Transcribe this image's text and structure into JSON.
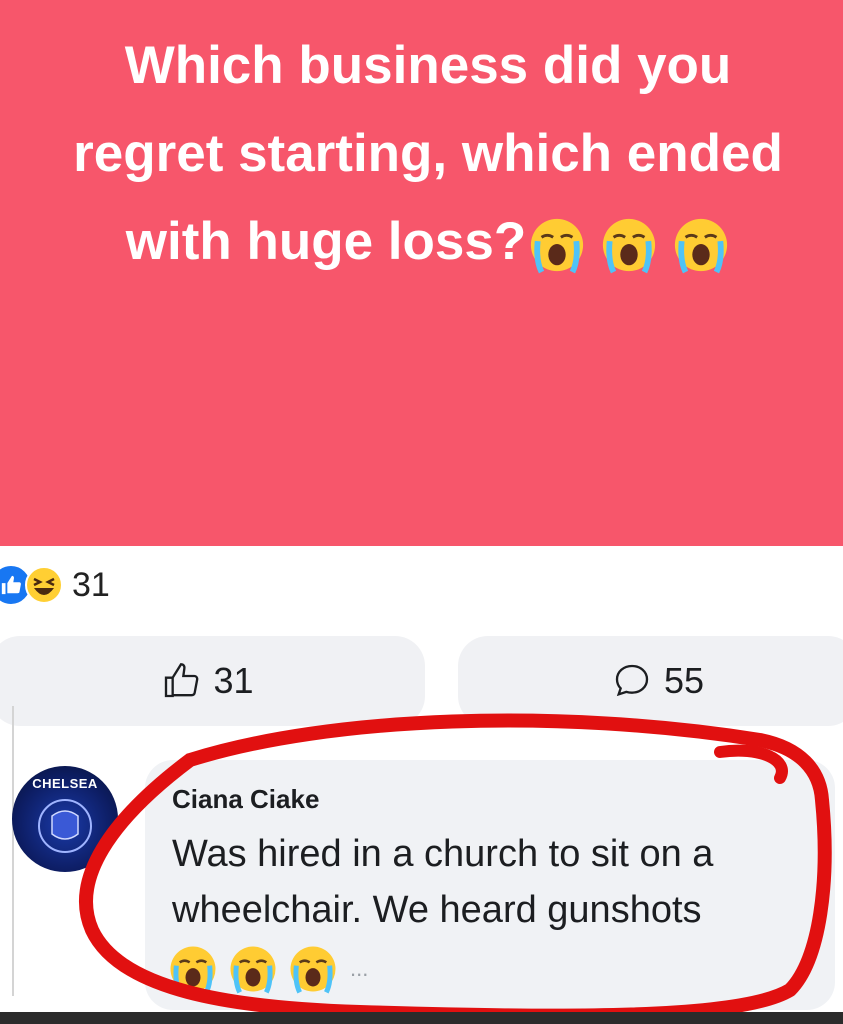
{
  "post": {
    "line1": "Which business did you",
    "line2": "regret starting, which ended",
    "line3": "with huge loss?",
    "background": "#f7566b",
    "emojis": [
      "crying-face-icon",
      "crying-face-icon",
      "crying-face-icon"
    ]
  },
  "reactions": {
    "count": "31",
    "icons": [
      "like-icon",
      "laughing-face-icon"
    ]
  },
  "actions": {
    "like_count": "31",
    "comment_count": "55"
  },
  "comment": {
    "avatar_label": "CHELSEA",
    "author": "Ciana Ciake",
    "text": "Was hired in a church to sit on a wheelchair. We heard gunshots",
    "emojis": [
      "crying-face-icon",
      "crying-face-icon",
      "crying-face-icon"
    ],
    "ellipsis": "...",
    "highlight_color": "#e11010"
  }
}
